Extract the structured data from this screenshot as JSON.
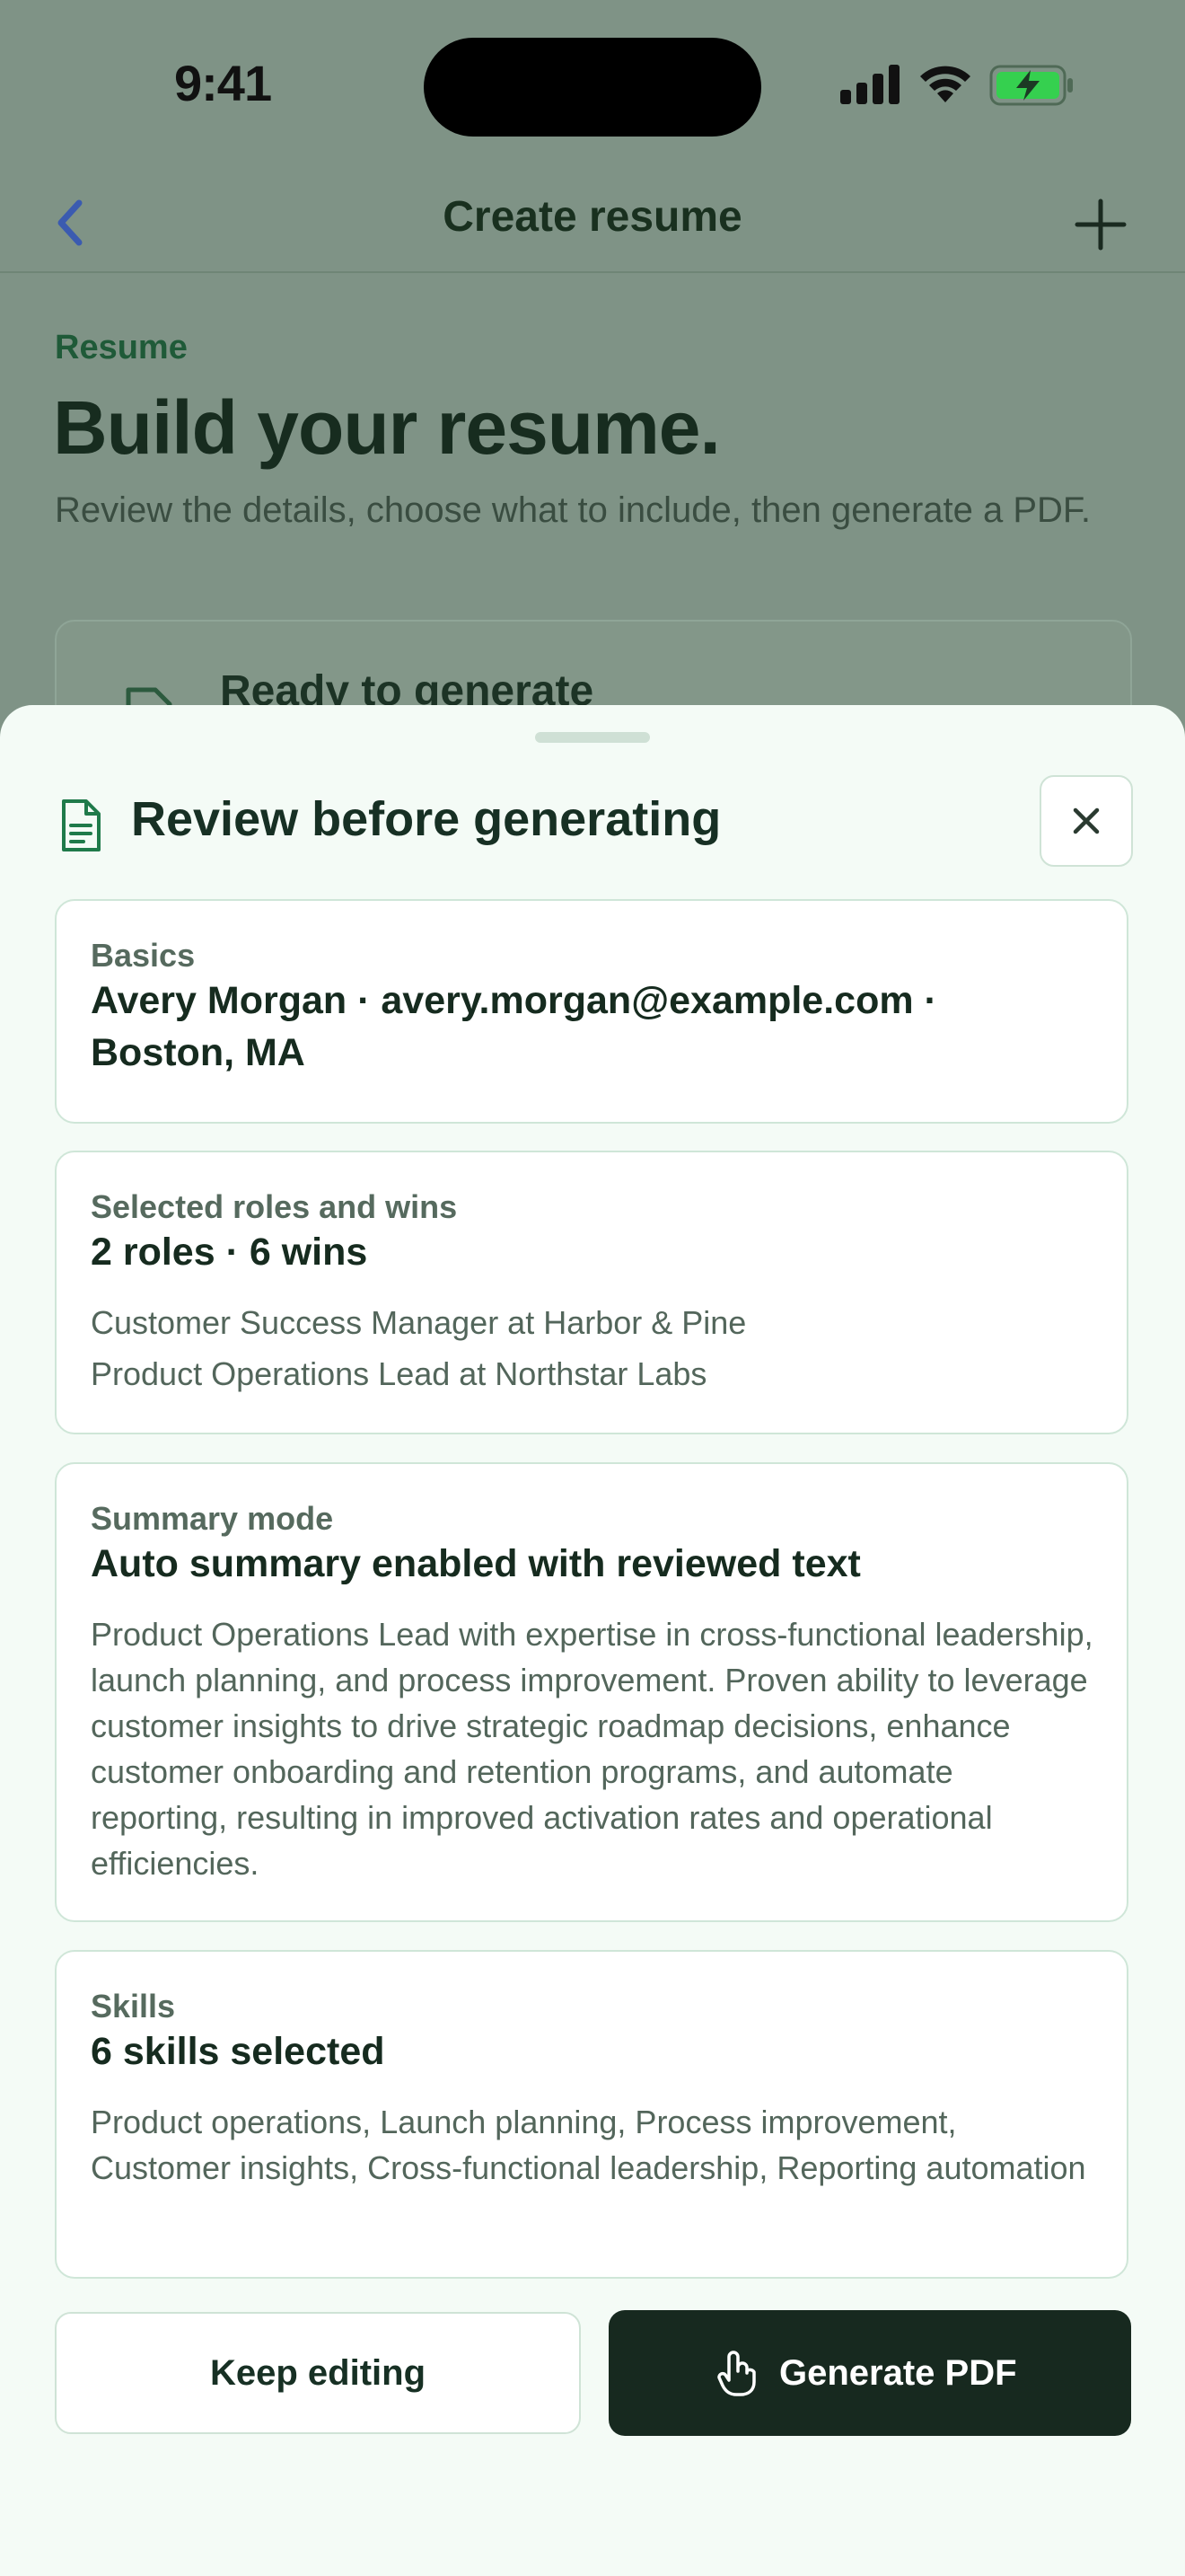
{
  "status": {
    "time": "9:41"
  },
  "nav": {
    "title": "Create resume"
  },
  "page": {
    "eyebrow": "Resume",
    "heading": "Build your resume.",
    "description": "Review the details, choose what to include, then generate a PDF.",
    "ready_card_title": "Ready to generate"
  },
  "sheet": {
    "title": "Review before generating",
    "basics": {
      "label": "Basics",
      "value": "Avery Morgan · avery.morgan@example.com · Boston, MA"
    },
    "roles": {
      "label": "Selected roles and wins",
      "value": "2 roles · 6 wins",
      "items": [
        "Customer Success Manager at Harbor & Pine",
        "Product Operations Lead at Northstar Labs"
      ]
    },
    "summary": {
      "label": "Summary mode",
      "value": "Auto summary enabled with reviewed text",
      "text": "Product Operations Lead with expertise in cross-functional leadership, launch planning, and process improvement. Proven ability to leverage customer insights to drive strategic roadmap decisions, enhance customer onboarding and retention programs, and automate reporting, resulting in improved activation rates and operational efficiencies."
    },
    "skills": {
      "label": "Skills",
      "value": "6 skills selected",
      "text": "Product operations, Launch planning, Process improvement, Customer insights, Cross-functional leadership, Reporting automation"
    },
    "actions": {
      "keep_editing": "Keep editing",
      "generate": "Generate PDF"
    }
  },
  "colors": {
    "accent": "#1f7a4a",
    "primary_button": "#17291f",
    "sheet_background": "#f4fbf6",
    "battery_charge": "#35d04f"
  },
  "icons": [
    "back-chevron-icon",
    "plus-icon",
    "document-icon",
    "close-icon",
    "touch-pdf-icon",
    "signal-icon",
    "wifi-icon",
    "battery-charging-icon"
  ]
}
